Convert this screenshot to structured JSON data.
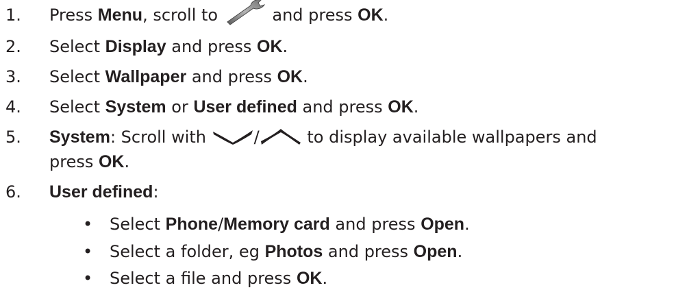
{
  "steps": [
    {
      "number": "1.",
      "parts": [
        "Press ",
        "Menu",
        ", scroll to ",
        " and press ",
        "OK",
        "."
      ],
      "icon": "wrench-icon"
    },
    {
      "number": "2.",
      "parts": [
        "Select ",
        "Display",
        " and press ",
        "OK",
        "."
      ]
    },
    {
      "number": "3.",
      "parts": [
        "Select ",
        "Wallpaper",
        " and press ",
        "OK",
        "."
      ]
    },
    {
      "number": "4.",
      "parts": [
        "Select ",
        "System",
        " or ",
        "User defined",
        " and press ",
        "OK",
        "."
      ]
    },
    {
      "number": "5.",
      "parts": [
        "System",
        ": Scroll with ",
        "/",
        " to display available wallpapers and"
      ],
      "cont": [
        "press ",
        "OK",
        "."
      ],
      "icons": [
        "chevron-down-icon",
        "chevron-up-icon"
      ]
    },
    {
      "number": "6.",
      "parts": [
        "User defined",
        ":"
      ]
    }
  ],
  "bullets": [
    {
      "symbol": "•",
      "parts": [
        "Select ",
        "Phone",
        "/",
        "Memory card",
        " and press ",
        "Open",
        "."
      ]
    },
    {
      "symbol": "•",
      "parts": [
        "Select a folder, eg ",
        "Photos",
        " and press ",
        "Open",
        "."
      ]
    },
    {
      "symbol": "•",
      "parts": [
        "Select a file and press ",
        "OK",
        "."
      ]
    }
  ],
  "colors": {
    "text": "#231f20",
    "icon": "#231f20"
  }
}
